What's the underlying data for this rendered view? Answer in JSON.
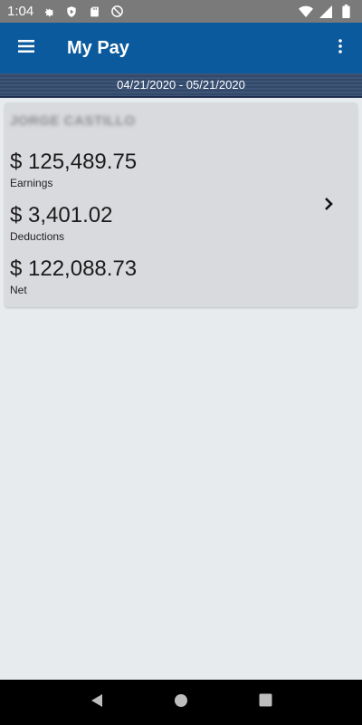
{
  "status_bar": {
    "time": "1:04",
    "left_icons": [
      "gear-icon",
      "shield-play-icon",
      "sd-card-icon",
      "no-disturb-icon"
    ],
    "right_icons": [
      "wifi-icon",
      "signal-icon",
      "battery-icon"
    ]
  },
  "app_bar": {
    "title": "My Pay",
    "menu_icon": "hamburger-menu-icon",
    "overflow_icon": "more-vert-icon"
  },
  "date_range": "04/21/2020 - 05/21/2020",
  "pay_card": {
    "employee_name": "JORGE CASTILLO",
    "earnings": {
      "amount": "$ 125,489.75",
      "label": "Earnings"
    },
    "deductions": {
      "amount": "$ 3,401.02",
      "label": "Deductions"
    },
    "net": {
      "amount": "$ 122,088.73",
      "label": "Net"
    },
    "chevron_icon": "chevron-right-icon"
  },
  "nav_bar": {
    "icons": [
      "back-icon",
      "home-icon",
      "recents-icon"
    ]
  },
  "colors": {
    "app_bar": "#0b5a9e",
    "date_band": "#3d5577",
    "background": "#e8ebed",
    "card": "#d8dadd"
  }
}
